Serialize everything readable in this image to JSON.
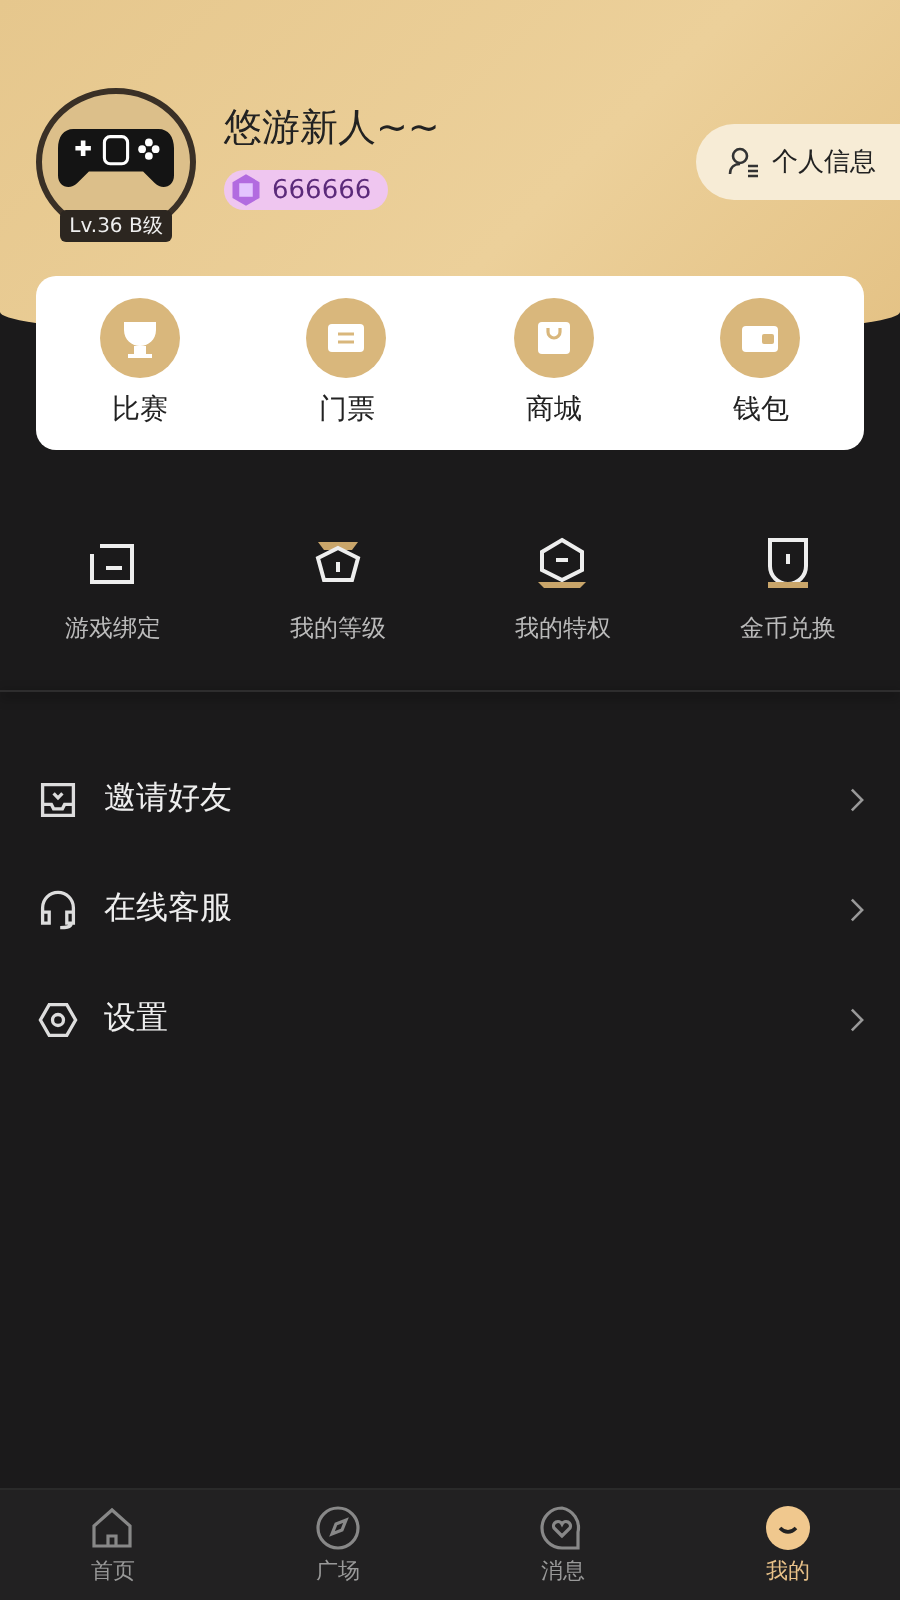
{
  "profile": {
    "avatar_badge": "Lv.36 B级",
    "name": "悠游新人~~",
    "coins": "666666",
    "info_button": "个人信息"
  },
  "quick_actions": [
    {
      "label": "比赛"
    },
    {
      "label": "门票"
    },
    {
      "label": "商城"
    },
    {
      "label": "钱包"
    }
  ],
  "features": [
    {
      "label": "游戏绑定"
    },
    {
      "label": "我的等级"
    },
    {
      "label": "我的特权"
    },
    {
      "label": "金币兑换"
    }
  ],
  "menu": [
    {
      "label": "邀请好友"
    },
    {
      "label": "在线客服"
    },
    {
      "label": "设置"
    }
  ],
  "tab_bar": [
    {
      "label": "首页",
      "selected": false
    },
    {
      "label": "广场",
      "selected": false
    },
    {
      "label": "消息",
      "selected": false
    },
    {
      "label": "我的",
      "selected": true
    }
  ]
}
